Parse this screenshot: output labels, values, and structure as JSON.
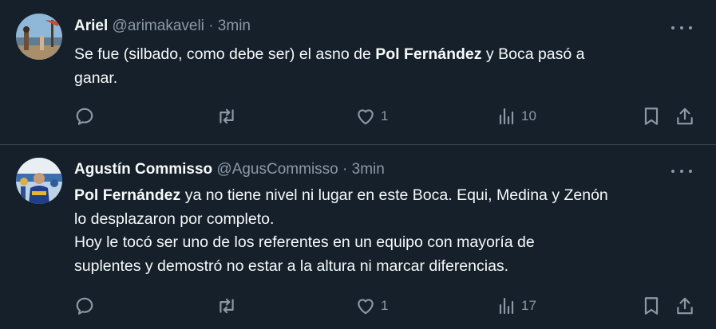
{
  "colors": {
    "background": "#15202b",
    "text": "#f7f9f9",
    "secondary": "#8b98a5",
    "divider": "#38444d"
  },
  "tweets": [
    {
      "name": "Ariel",
      "handle": "@arimakaveli",
      "separator": "·",
      "time": "3min",
      "text": {
        "l1_a": "Se fue (silbado, como debe ser) el asno de ",
        "l1_b": "Pol Fernández",
        "l1_c": " y Boca pasó a",
        "l2": "ganar."
      },
      "actions": {
        "likes": "1",
        "views": "10"
      },
      "icons": [
        "reply-icon",
        "retweet-icon",
        "heart-icon",
        "views-icon",
        "bookmark-icon",
        "share-icon"
      ]
    },
    {
      "name": "Agustín Commisso",
      "handle": "@AgusCommisso",
      "separator": "·",
      "time": "3min",
      "text": {
        "l1_a": "Pol Fernández",
        "l1_b": " ya no tiene nivel ni lugar en este Boca. Equi, Medina y Zenón",
        "l2": "lo desplazaron por completo.",
        "l3": "Hoy le tocó ser uno de los referentes en un equipo con mayoría de",
        "l4": "suplentes y demostró no estar a la altura ni marcar diferencias."
      },
      "actions": {
        "likes": "1",
        "views": "17"
      },
      "icons": [
        "reply-icon",
        "retweet-icon",
        "heart-icon",
        "views-icon",
        "bookmark-icon",
        "share-icon"
      ]
    }
  ]
}
